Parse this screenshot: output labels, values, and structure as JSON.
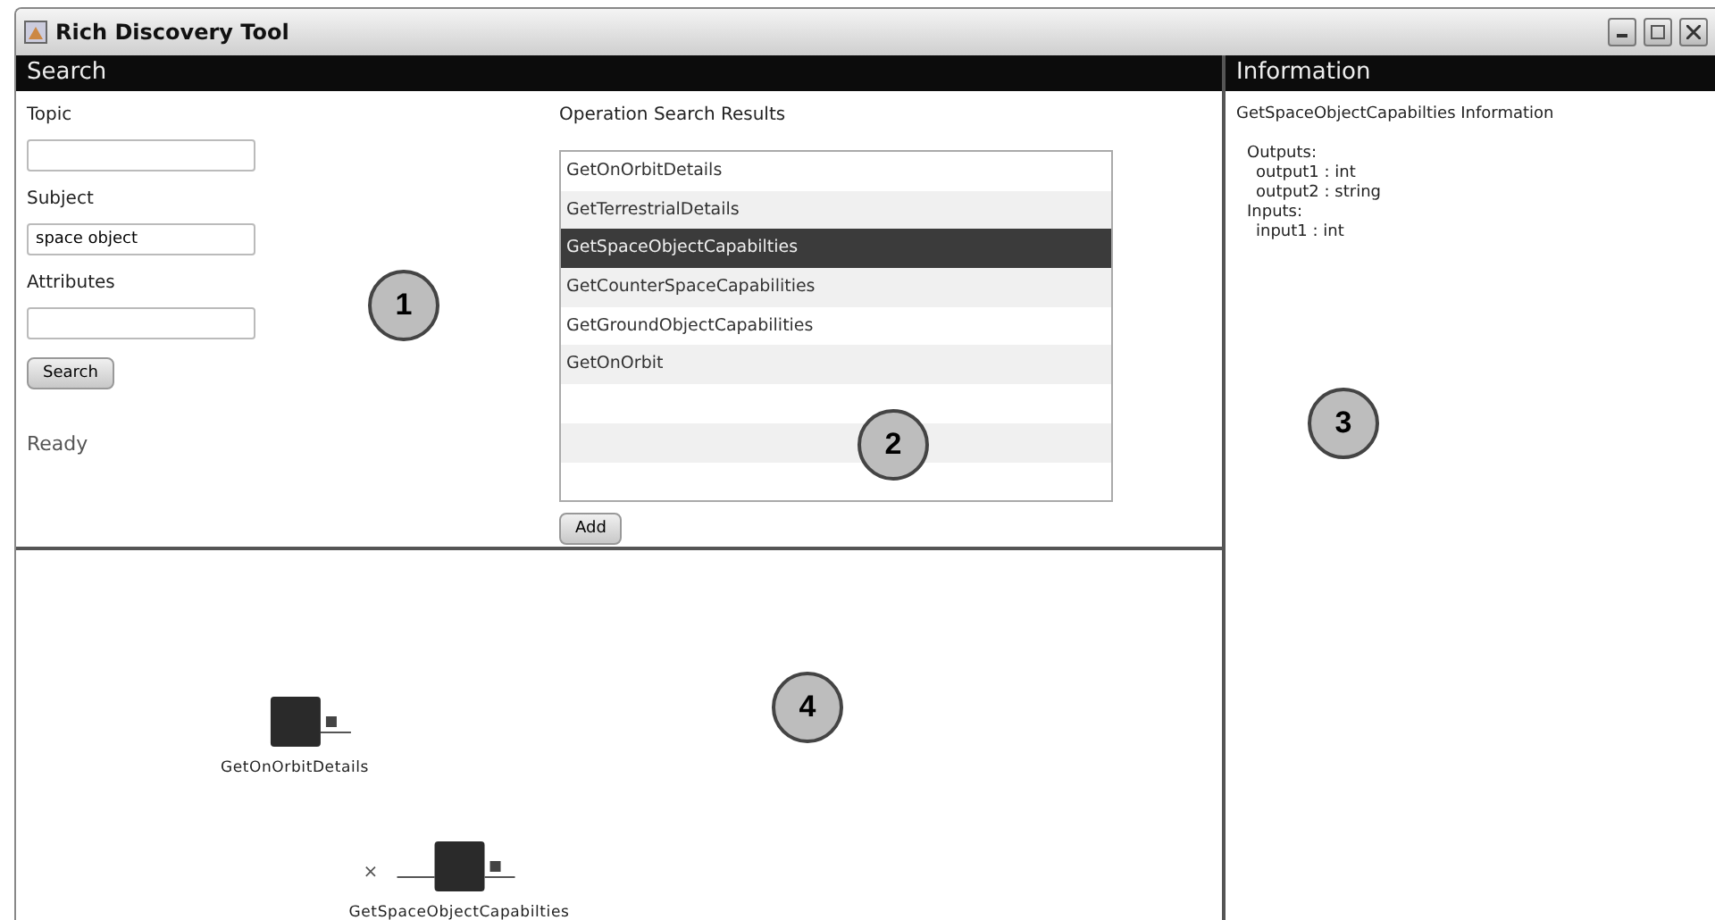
{
  "window": {
    "title": "Rich Discovery Tool"
  },
  "search": {
    "header": "Search",
    "fields": [
      {
        "label": "Topic"
      },
      {
        "label": "Subject",
        "value": "space object"
      },
      {
        "label": "Attributes"
      }
    ],
    "button": "Search",
    "status": "Ready"
  },
  "results": {
    "title": "Operation Search Results",
    "items": [
      {
        "label": "GetOnOrbitDetails",
        "selected": false
      },
      {
        "label": "GetTerrestrialDetails",
        "selected": false
      },
      {
        "label": "GetSpaceObjectCapabilties",
        "selected": true
      },
      {
        "label": "GetCounterSpaceCapabilities",
        "selected": false
      },
      {
        "label": "GetGroundObjectCapabilities",
        "selected": false
      },
      {
        "label": "GetOnOrbit",
        "selected": false
      }
    ],
    "button": "Add"
  },
  "information": {
    "header": "Information",
    "title": "GetSpaceObjectCapabilties Information",
    "sections": [
      {
        "label": "Outputs:",
        "children": [
          {
            "label": "output1 : int"
          },
          {
            "label": "output2 : string"
          }
        ]
      },
      {
        "label": "Inputs:",
        "children": [
          {
            "label": "input1 : int"
          }
        ]
      }
    ]
  },
  "canvas": {
    "nodes": [
      {
        "label": "GetOnOrbitDetails"
      },
      {
        "label": "GetSpaceObjectCapabilties",
        "input_mark": "×"
      }
    ]
  },
  "callouts": [
    "1",
    "2",
    "3",
    "4"
  ]
}
